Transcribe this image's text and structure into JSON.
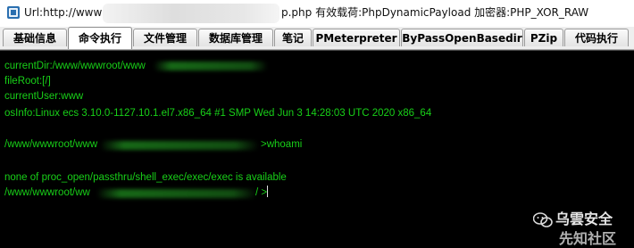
{
  "window": {
    "title_left": "Url:http://www",
    "title_right": "p.php 有效载荷:PhpDynamicPayload 加密器:PHP_XOR_RAW"
  },
  "tabs": [
    {
      "label": "基础信息",
      "active": false
    },
    {
      "label": "命令执行",
      "active": true
    },
    {
      "label": "文件管理",
      "active": false
    },
    {
      "label": "数据库管理",
      "active": false
    },
    {
      "label": "笔记",
      "active": false
    },
    {
      "label": "PMeterpreter",
      "active": false
    },
    {
      "label": "ByPassOpenBasedir",
      "active": false
    },
    {
      "label": "PZip",
      "active": false
    },
    {
      "label": "代码执行",
      "active": false
    }
  ],
  "console": {
    "lines": [
      "currentDir:/www/wwwroot/www",
      "fileRoot:[/]",
      "currentUser:www",
      "osInfo:Linux ecs 3.10.0-1127.10.1.el7.x86_64 #1 SMP Wed Jun 3 14:28:03 UTC 2020 x86_64",
      "/www/wwwroot/www",
      ">whoami",
      "none of proc_open/passthru/shell_exec/exec/exec is available",
      "/www/wwwroot/ww",
      "/ >"
    ],
    "text_color": "#18d018",
    "background": "#000000"
  },
  "watermark": {
    "line1": "乌雲安全",
    "line2": "先知社区"
  }
}
